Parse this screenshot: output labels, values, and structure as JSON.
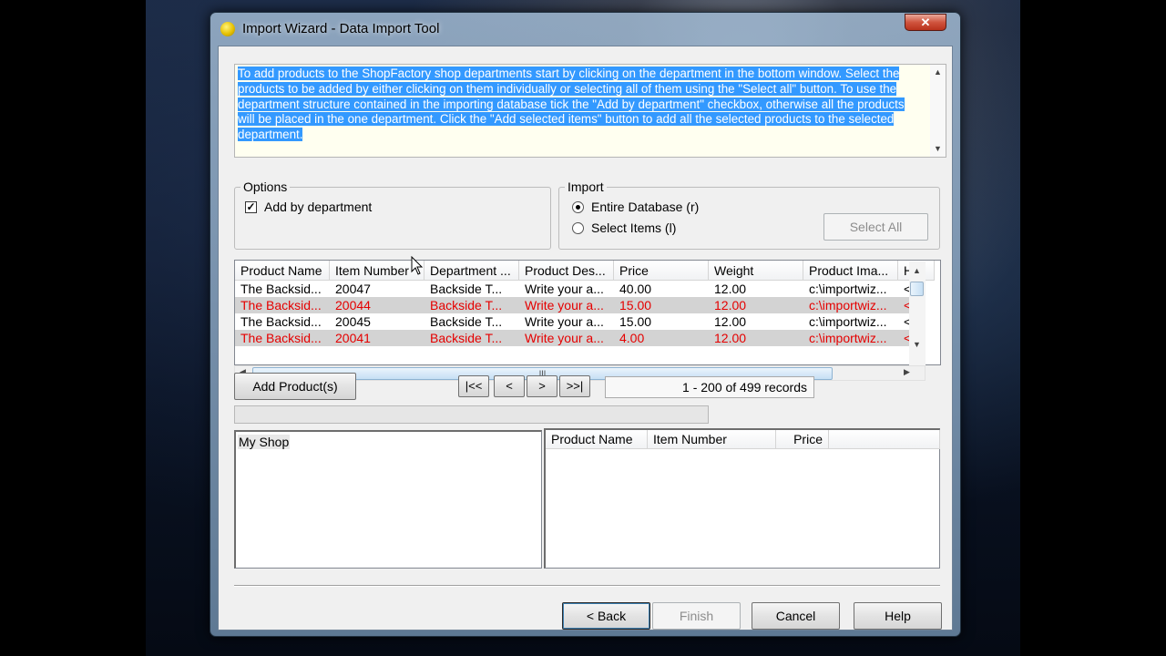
{
  "window": {
    "title": "Import Wizard - Data Import Tool",
    "close_symbol": "✕"
  },
  "instructions": "To add products to the ShopFactory shop departments start by clicking on the department in the bottom window. Select the products to be added by either clicking on them individually or selecting all of them using the \"Select all\" button.  To use the department structure contained in the importing database tick the \"Add by department\" checkbox, otherwise all the products will be placed in the one department.  Click the \"Add selected items\" button to add all the selected products to the selected department.",
  "options": {
    "group_label": "Options",
    "add_by_department_label": "Add by department",
    "add_by_department_checked": true
  },
  "import": {
    "group_label": "Import",
    "entire_database_label": "Entire Database (r)",
    "select_items_label": "Select Items (l)",
    "selected": "entire_database",
    "select_all_label": "Select All"
  },
  "grid": {
    "columns": [
      "Product Name",
      "Item Number",
      "Department ...",
      "Product Des...",
      "Price",
      "Weight",
      "Product Ima...",
      "He"
    ],
    "rows": [
      [
        "The Backsid...",
        "20047",
        "Backside T...",
        "Write your a...",
        "40.00",
        "12.00",
        "c:\\importwiz...",
        "<N"
      ],
      [
        "The Backsid...",
        "20044",
        "Backside T...",
        "Write your a...",
        "15.00",
        "12.00",
        "c:\\importwiz...",
        "<N"
      ],
      [
        "The Backsid...",
        "20045",
        "Backside T...",
        "Write your a...",
        "15.00",
        "12.00",
        "c:\\importwiz...",
        "<N"
      ],
      [
        "The Backsid...",
        "20041",
        "Backside T...",
        "Write your a...",
        "4.00",
        "12.00",
        "c:\\importwiz...",
        "<N"
      ]
    ],
    "alt_row_color": "#e50000",
    "scroll_grip": "III"
  },
  "navigation": {
    "add_products_label": "Add Product(s)",
    "first_label": "|<<",
    "prev_label": "<",
    "next_label": ">",
    "last_label": ">>|",
    "records_text": "1 - 200 of 499 records"
  },
  "tree": {
    "root_label": "My Shop"
  },
  "selected_list": {
    "columns": [
      "Product Name",
      "Item Number",
      "Price"
    ]
  },
  "footer": {
    "back_label": "< Back",
    "finish_label": "Finish",
    "cancel_label": "Cancel",
    "help_label": "Help"
  },
  "colors": {
    "selection": "#3399ff",
    "close_button": "#c8432a"
  }
}
